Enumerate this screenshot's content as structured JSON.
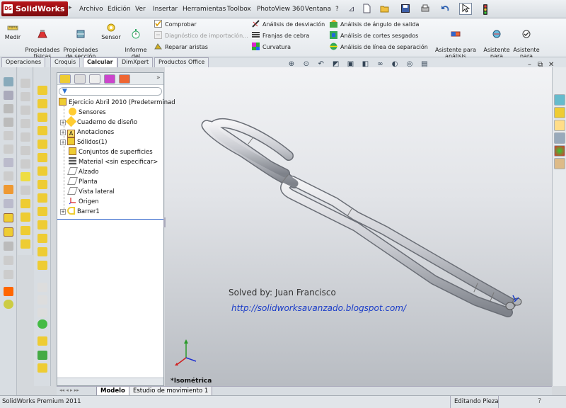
{
  "app": {
    "logo": "SolidWorks",
    "colors": {
      "brand_red": "#b8141a",
      "viewport_top": "#f2f3f5",
      "viewport_bottom": "#b8bcc2",
      "selection_blue": "#1a3cc8"
    }
  },
  "menu": [
    "Archivo",
    "Edición",
    "Ver",
    "Insertar",
    "Herramientas",
    "Toolbox",
    "PhotoView 360",
    "Ventana",
    "?"
  ],
  "quick_access_icons": [
    "pin-icon",
    "new-document-icon",
    "open-folder-icon",
    "save-icon",
    "print-icon",
    "undo-icon",
    "select-cursor-icon",
    "rebuild-icon"
  ],
  "command_manager": {
    "big_buttons": [
      "Medir",
      "Propiedades\nfísicas",
      "Propiedades\nde sección",
      "Sensor",
      "Informe\ndel\ntiempo..."
    ],
    "column_a": [
      "Comprobar",
      "Diagnóstico de importación...",
      "Reparar aristas"
    ],
    "column_b": [
      "Análisis de desviación",
      "Franjas de cebra",
      "Curvatura"
    ],
    "column_c": [
      "Análisis de ángulo de salida",
      "Análisis de cortes sesgados",
      "Análisis de línea de separación"
    ],
    "right_buttons": [
      "Asistente para\nanálisis\nSimulationXpress",
      "Asistente\npara\nanálisi...",
      "Asistente\npara\nanálisi..."
    ]
  },
  "tabs": [
    "Operaciones",
    "Croquis",
    "Calcular",
    "DimXpert",
    "Productos Office"
  ],
  "active_tab": "Calcular",
  "feature_tree": {
    "root": "Ejercicio Abril 2010  (Predeterminad",
    "items": [
      {
        "label": "Sensores",
        "icon": "sensor-icon",
        "expandable": false
      },
      {
        "label": "Cuaderno de diseño",
        "icon": "design-binder-icon",
        "expandable": true
      },
      {
        "label": "Anotaciones",
        "icon": "annotations-icon",
        "expandable": true
      },
      {
        "label": "Sólidos(1)",
        "icon": "solid-bodies-icon",
        "expandable": true
      },
      {
        "label": "Conjuntos de superficies",
        "icon": "surface-bodies-icon",
        "expandable": false
      },
      {
        "label": "Material <sin especificar>",
        "icon": "material-icon",
        "expandable": false
      },
      {
        "label": "Alzado",
        "icon": "plane-icon",
        "expandable": false
      },
      {
        "label": "Planta",
        "icon": "plane-icon",
        "expandable": false
      },
      {
        "label": "Vista lateral",
        "icon": "plane-icon",
        "expandable": false
      },
      {
        "label": "Origen",
        "icon": "origin-icon",
        "expandable": false
      },
      {
        "label": "Barrer1",
        "icon": "sweep-icon",
        "expandable": true
      }
    ]
  },
  "viewport": {
    "watermark_line1": "Solved by: Juan Francisco",
    "watermark_line2": "http://solidworksavanzado.blogspot.com/",
    "view_name": "*Isométrica"
  },
  "bottom_tabs": [
    "Modelo",
    "Estudio de movimiento 1"
  ],
  "status": {
    "product": "SolidWorks Premium 2011",
    "mode": "Editando Pieza"
  }
}
